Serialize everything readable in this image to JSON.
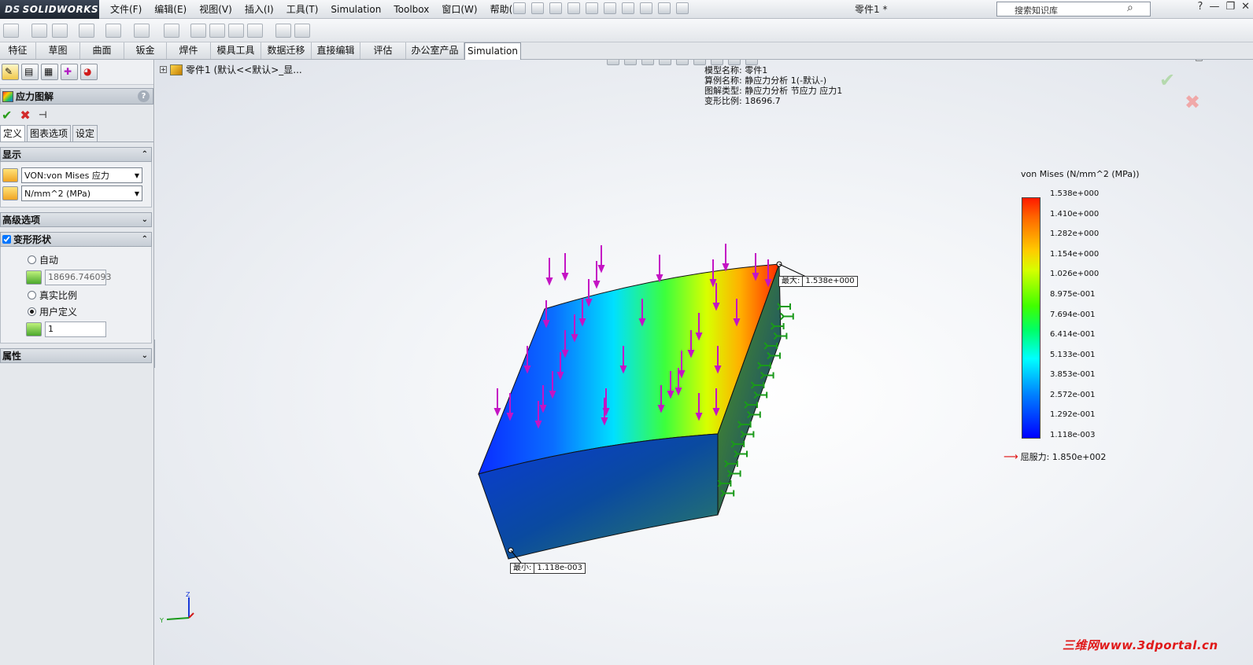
{
  "app": {
    "logo": "SOLIDWORKS",
    "doc_title": "零件1 *",
    "menu": [
      "文件(F)",
      "编辑(E)",
      "视图(V)",
      "插入(I)",
      "工具(T)",
      "Simulation",
      "Toolbox",
      "窗口(W)",
      "帮助(H)"
    ],
    "search_placeholder": "搜索知识库"
  },
  "tabs": [
    "特征",
    "草图",
    "曲面",
    "钣金",
    "焊件",
    "模具工具",
    "数据迁移",
    "直接编辑",
    "评估",
    "办公室产品",
    "Simulation"
  ],
  "active_tab": "Simulation",
  "property_manager": {
    "title": "应力图解",
    "help": "?",
    "subtabs": [
      "定义",
      "图表选项",
      "设定"
    ],
    "display": {
      "header": "显示",
      "component": "VON:von Mises 应力",
      "units": "N/mm^2 (MPa)"
    },
    "advanced": {
      "header": "高级选项"
    },
    "deformed": {
      "header": "变形形状",
      "auto_label": "自动",
      "auto_value": "18696.746093",
      "true_scale_label": "真实比例",
      "user_defined_label": "用户定义",
      "user_value": "1"
    },
    "properties": {
      "header": "属性"
    }
  },
  "tree": {
    "label": "零件1  (默认<<默认>_显..."
  },
  "info": {
    "line1": "模型名称: 零件1",
    "line2": "算例名称: 静应力分析 1(-默认-)",
    "line3": "图解类型: 静应力分析 节应力 应力1",
    "line4": "变形比例: 18696.7"
  },
  "legend": {
    "title": "von Mises (N/mm^2 (MPa))",
    "ticks": [
      "1.538e+000",
      "1.410e+000",
      "1.282e+000",
      "1.154e+000",
      "1.026e+000",
      "8.975e-001",
      "7.694e-001",
      "6.414e-001",
      "5.133e-001",
      "3.853e-001",
      "2.572e-001",
      "1.292e-001",
      "1.118e-003"
    ],
    "yield_label": "屈服力: 1.850e+002"
  },
  "callouts": {
    "max_label": "最大:",
    "max_value": "1.538e+000",
    "min_label": "最小:",
    "min_value": "1.118e-003"
  },
  "triad": {
    "z": "Z",
    "y": "Y"
  },
  "watermark": "三维网www.3dportal.cn"
}
